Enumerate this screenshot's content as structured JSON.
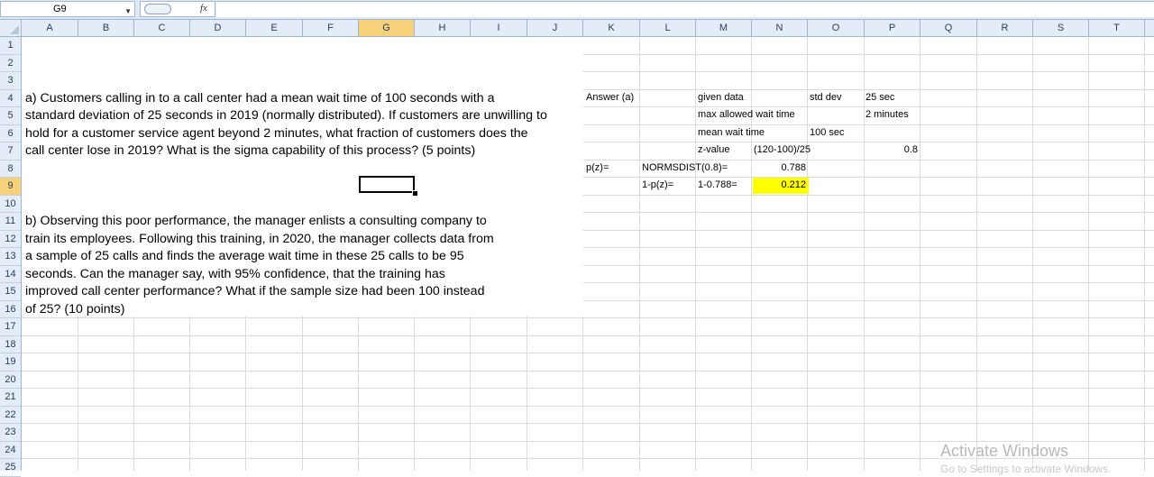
{
  "formula_bar": {
    "name_box": "G9",
    "fx_label": "fx",
    "formula": ""
  },
  "columns": [
    "A",
    "B",
    "C",
    "D",
    "E",
    "F",
    "G",
    "H",
    "I",
    "J",
    "K",
    "L",
    "M",
    "N",
    "O",
    "P",
    "Q",
    "R",
    "S",
    "T"
  ],
  "selected_column": "G",
  "rows": [
    "1",
    "2",
    "3",
    "4",
    "5",
    "6",
    "7",
    "8",
    "9",
    "10",
    "11",
    "12",
    "13",
    "14",
    "15",
    "16",
    "17",
    "18",
    "19",
    "20",
    "21",
    "22",
    "23",
    "24",
    "25"
  ],
  "selected_row": "9",
  "question_a": [
    "a) Customers calling in to a call center had a mean wait time of 100 seconds with a",
    "standard deviation of 25 seconds in 2019 (normally distributed). If customers are unwilling to",
    "hold for a customer service agent beyond 2 minutes, what fraction of customers does the",
    "call center lose in 2019? What is the sigma capability of this process?    (5 points)"
  ],
  "question_b": [
    "b) Observing this poor performance, the manager enlists a consulting company to",
    "train its employees. Following this training, in 2020, the manager collects data from",
    "a sample of 25 calls and finds the average wait time in these 25 calls to be 95",
    "seconds. Can the manager say, with 95% confidence, that the training has",
    "improved call center performance? What if the sample size had been 100 instead",
    "of 25? (10 points)"
  ],
  "answer": {
    "k4": "Answer (a)",
    "m4": "given data",
    "o4": "std dev",
    "p4": "25 sec",
    "m5": "max allowed wait time",
    "p5": "2 minutes",
    "m6": "mean wait time",
    "o6": "100 sec",
    "m7": "z-value",
    "n7": "(120-100)/25",
    "p7": "0.8",
    "k8": "p(z)=",
    "l8": "NORMSDIST(0.8)=",
    "n8": "0.788",
    "l9": "1-p(z)=",
    "m9": "1-0.788=",
    "n9": "0.212"
  },
  "highlight_color": "#ffff00",
  "watermark": {
    "title": "Activate Windows",
    "sub": "Go to Settings to activate Windows."
  }
}
